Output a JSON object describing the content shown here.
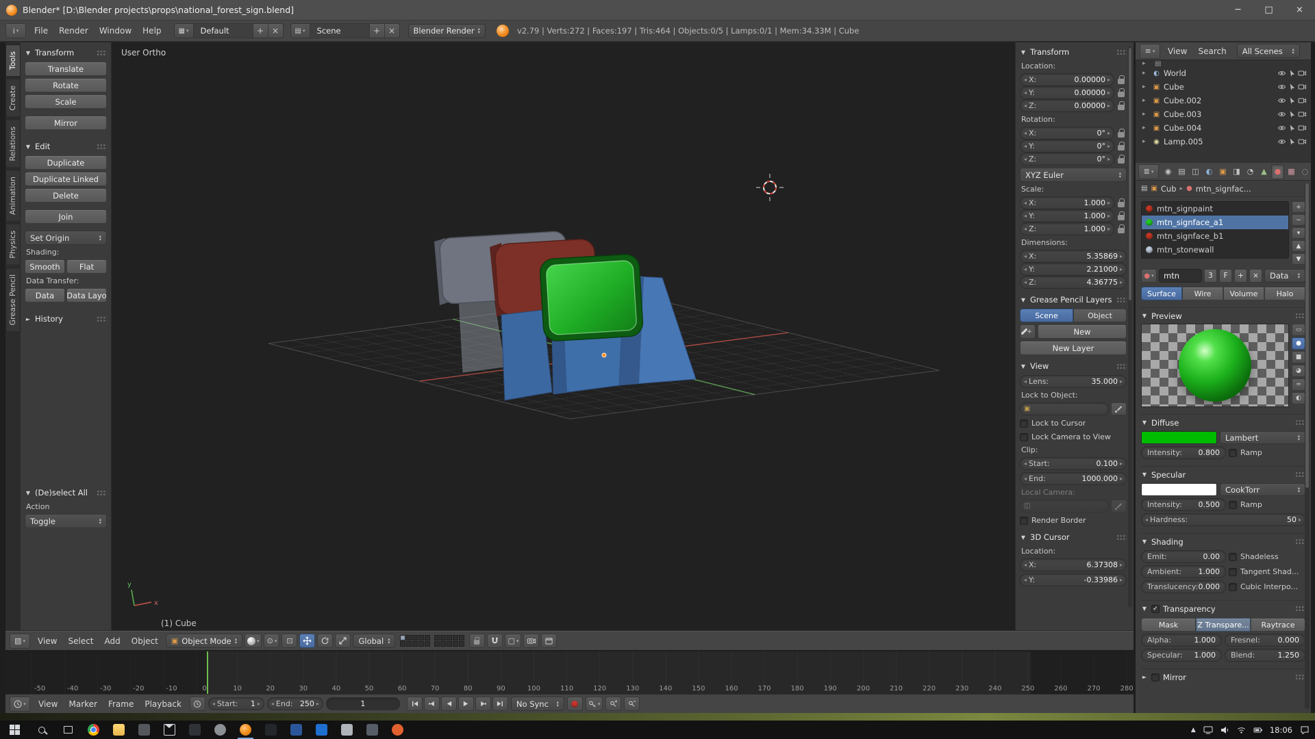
{
  "titlebar": {
    "title": "Blender* [D:\\Blender projects\\props\\national_forest_sign.blend]"
  },
  "topbar": {
    "menus": [
      "File",
      "Render",
      "Window",
      "Help"
    ],
    "layout_value": "Default",
    "scene_value": "Scene",
    "engine_value": "Blender Render",
    "stats": "v2.79 | Verts:272 | Faces:197 | Tris:464 | Objects:0/5 | Lamps:0/1 | Mem:34.33M | Cube"
  },
  "toolshelf": {
    "tabs": [
      {
        "label": "Tools",
        "state": "active"
      },
      {
        "label": "Create",
        "state": ""
      },
      {
        "label": "Relations",
        "state": ""
      },
      {
        "label": "Animation",
        "state": ""
      },
      {
        "label": "Physics",
        "state": ""
      },
      {
        "label": "Grease Pencil",
        "state": ""
      }
    ],
    "transform_title": "Transform",
    "translate": "Translate",
    "rotate": "Rotate",
    "scale": "Scale",
    "mirror": "Mirror",
    "edit_title": "Edit",
    "duplicate": "Duplicate",
    "duplicate_linked": "Duplicate Linked",
    "delete": "Delete",
    "join": "Join",
    "set_origin": "Set Origin",
    "shading_label": "Shading:",
    "smooth": "Smooth",
    "flat": "Flat",
    "data_transfer_label": "Data Transfer:",
    "data_btn": "Data",
    "data_layout_btn": "Data Layo",
    "history_title": "History",
    "redo_title": "(De)select All",
    "action_label": "Action",
    "action_value": "Toggle"
  },
  "viewport": {
    "view_label": "User Ortho",
    "status_label": "(1) Cube"
  },
  "view3d_header": {
    "menus": [
      "View",
      "Select",
      "Add",
      "Object"
    ],
    "mode_value": "Object Mode",
    "orientation_value": "Global"
  },
  "npanel": {
    "transform_title": "Transform",
    "location_label": "Location:",
    "location_rows": [
      {
        "label": "X:",
        "value": "0.00000"
      },
      {
        "label": "Y:",
        "value": "0.00000"
      },
      {
        "label": "Z:",
        "value": "0.00000"
      }
    ],
    "rotation_label": "Rotation:",
    "rotation_rows": [
      {
        "label": "X:",
        "value": "0°"
      },
      {
        "label": "Y:",
        "value": "0°"
      },
      {
        "label": "Z:",
        "value": "0°"
      }
    ],
    "rotation_mode_value": "XYZ Euler",
    "scale_label": "Scale:",
    "scale_rows": [
      {
        "label": "X:",
        "value": "1.000"
      },
      {
        "label": "Y:",
        "value": "1.000"
      },
      {
        "label": "Z:",
        "value": "1.000"
      }
    ],
    "dimensions_label": "Dimensions:",
    "dimension_rows": [
      {
        "label": "X:",
        "value": "5.35869"
      },
      {
        "label": "Y:",
        "value": "2.21000"
      },
      {
        "label": "Z:",
        "value": "4.36775"
      }
    ],
    "gp_title": "Grease Pencil Layers",
    "gp_scene": "Scene",
    "gp_object": "Object",
    "gp_new": "New",
    "gp_new_layer": "New Layer",
    "view_title": "View",
    "lens_label": "Lens:",
    "lens_value": "35.000",
    "lock_to_object_label": "Lock to Object:",
    "lock_to_cursor_label": "Lock to Cursor",
    "lock_camera_label": "Lock Camera to View",
    "clip_label": "Clip:",
    "clip_start_label": "Start:",
    "clip_start_value": "0.100",
    "clip_end_label": "End:",
    "clip_end_value": "1000.000",
    "local_camera_label": "Local Camera:",
    "render_border_label": "Render Border",
    "cursor_title": "3D Cursor",
    "cursor_location_label": "Location:",
    "cursor_rows": [
      {
        "label": "X:",
        "value": "6.37308"
      },
      {
        "label": "Y:",
        "value": "-0.33986"
      }
    ]
  },
  "outliner": {
    "menus": [
      "View",
      "Search"
    ],
    "scope_value": "All Scenes",
    "items": [
      {
        "name": "World",
        "icon": "world"
      },
      {
        "name": "Cube",
        "icon": "object"
      },
      {
        "name": "Cube.002",
        "icon": "object"
      },
      {
        "name": "Cube.003",
        "icon": "object"
      },
      {
        "name": "Cube.004",
        "icon": "object"
      },
      {
        "name": "Lamp.005",
        "icon": "lamp"
      }
    ]
  },
  "properties": {
    "tabs": [
      {
        "name": "render",
        "state": ""
      },
      {
        "name": "render-layers",
        "state": ""
      },
      {
        "name": "scene",
        "state": ""
      },
      {
        "name": "world",
        "state": ""
      },
      {
        "name": "object",
        "state": ""
      },
      {
        "name": "constraints",
        "state": ""
      },
      {
        "name": "modifiers",
        "state": ""
      },
      {
        "name": "object-data",
        "state": ""
      },
      {
        "name": "material",
        "state": "active"
      },
      {
        "name": "texture",
        "state": ""
      },
      {
        "name": "particles",
        "state": ""
      },
      {
        "name": "physics",
        "state": ""
      }
    ],
    "breadcrumb_object": "Cub",
    "breadcrumb_material": "mtn_signfac...",
    "slots": [
      {
        "name": "mtn_signpaint",
        "color": "#c03522",
        "state": ""
      },
      {
        "name": "mtn_signface_a1",
        "color": "#23c423",
        "state": "selected"
      },
      {
        "name": "mtn_signface_b1",
        "color": "#c03522",
        "state": ""
      },
      {
        "name": "mtn_stonewall",
        "color": "#b9c6d8",
        "state": ""
      }
    ],
    "name_value": "mtn",
    "users_value": "3",
    "fake_user_label": "F",
    "new_label": "+",
    "unlink_label": "×",
    "datablock_mode": "Data",
    "type_buttons": [
      {
        "label": "Surface",
        "state": "active"
      },
      {
        "label": "Wire",
        "state": ""
      },
      {
        "label": "Volume",
        "state": ""
      },
      {
        "label": "Halo",
        "state": ""
      }
    ],
    "preview_title": "Preview",
    "diffuse_title": "Diffuse",
    "diffuse_color": "#00bc00",
    "diffuse_shader": "Lambert",
    "diffuse_intensity_label": "Intensity:",
    "diffuse_intensity_value": "0.800",
    "diffuse_ramp": "Ramp",
    "specular_title": "Specular",
    "specular_color": "#ffffff",
    "specular_shader": "CookTorr",
    "specular_intensity_label": "Intensity:",
    "specular_intensity_value": "0.500",
    "specular_ramp": "Ramp",
    "hardness_label": "Hardness:",
    "hardness_value": "50",
    "shading_title": "Shading",
    "emit_label": "Emit:",
    "emit_value": "0.00",
    "shadeless_label": "Shadeless",
    "ambient_label": "Ambient:",
    "ambient_value": "1.000",
    "tangent_label": "Tangent Shad...",
    "translucency_label": "Translucency:",
    "translucency_value": "0.000",
    "cubic_label": "Cubic Interpo...",
    "transparency_title": "Transparency",
    "mask_label": "Mask",
    "ztransp_label": "Z Transpare...",
    "raytrace_label": "Raytrace",
    "alpha_label": "Alpha:",
    "alpha_value": "1.000",
    "fresnel_label": "Fresnel:",
    "fresnel_value": "0.000",
    "tspecular_label": "Specular:",
    "tspecular_value": "1.000",
    "blend_label": "Blend:",
    "blend_value": "1.250",
    "mirror_title": "Mirror"
  },
  "timeline": {
    "menus": [
      "View",
      "Marker",
      "Frame",
      "Playback"
    ],
    "start_label": "Start:",
    "start_value": "1",
    "end_label": "End:",
    "end_value": "250",
    "frame_value": "1",
    "sync_value": "No Sync",
    "ticks": [
      "-50",
      "-40",
      "-30",
      "-20",
      "-10",
      "0",
      "10",
      "20",
      "30",
      "40",
      "50",
      "60",
      "70",
      "80",
      "90",
      "100",
      "110",
      "120",
      "130",
      "140",
      "150",
      "160",
      "170",
      "180",
      "190",
      "200",
      "210",
      "220",
      "230",
      "240",
      "250",
      "260",
      "270",
      "280"
    ]
  },
  "taskbar": {
    "apps": [
      {
        "id": "chrome"
      },
      {
        "id": "explorer"
      },
      {
        "id": "app-gray-1"
      },
      {
        "id": "mail"
      },
      {
        "id": "app-dark-1"
      },
      {
        "id": "app-gray-2"
      },
      {
        "id": "blender"
      },
      {
        "id": "app-dark-2"
      },
      {
        "id": "app-blue-1"
      },
      {
        "id": "app-blue-2"
      },
      {
        "id": "app-gray-3"
      },
      {
        "id": "app-gray-4"
      },
      {
        "id": "app-orange-1"
      }
    ],
    "time": "18:06"
  }
}
